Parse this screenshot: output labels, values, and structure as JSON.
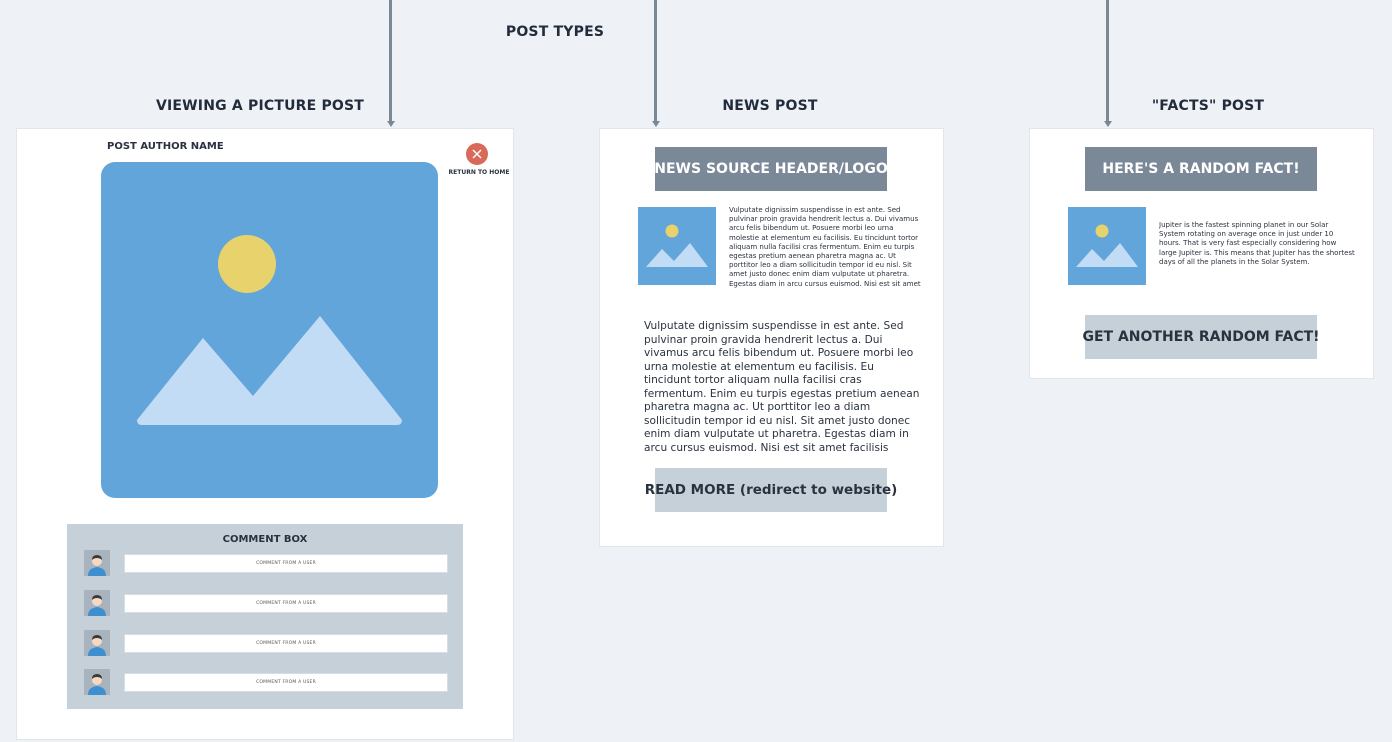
{
  "header": {
    "post_types_label": "POST TYPES"
  },
  "sections": {
    "picture": {
      "title": "VIEWING A PICTURE POST"
    },
    "news": {
      "title": "NEWS POST"
    },
    "facts": {
      "title": "\"FACTS\" POST"
    }
  },
  "picture_post": {
    "author_name": "POST AUTHOR NAME",
    "return_label": "RETURN TO HOME",
    "close_icon": "close-icon",
    "image_icon": "image-placeholder-icon",
    "comment_box": {
      "title": "COMMENT BOX",
      "comments": [
        {
          "text": "COMMENT FROM A USER"
        },
        {
          "text": "COMMENT FROM A USER"
        },
        {
          "text": "COMMENT FROM A USER"
        },
        {
          "text": "COMMENT FROM A USER"
        }
      ]
    }
  },
  "news_post": {
    "header_label": "NEWS SOURCE HEADER/LOGO",
    "summary": "Vulputate dignissim suspendisse in est ante. Sed pulvinar proin gravida hendrerit lectus a. Dui vivamus arcu felis bibendum ut. Posuere morbi leo urna molestie at elementum eu facilisis. Eu tincidunt tortor aliquam nulla facilisi cras fermentum. Enim eu turpis egestas pretium aenean pharetra magna ac. Ut porttitor leo a diam sollicitudin tempor id eu nisl. Sit amet justo donec enim diam vulputate ut pharetra. Egestas diam in arcu cursus euismod. Nisi est sit amet facilisis magna etiam tempor orci.",
    "body": "Vulputate dignissim suspendisse in est ante. Sed pulvinar proin gravida hendrerit lectus a. Dui vivamus arcu felis bibendum ut. Posuere morbi leo urna molestie at elementum eu facilisis. Eu tincidunt tortor aliquam nulla facilisi cras fermentum. Enim eu turpis egestas pretium aenean pharetra magna ac. Ut porttitor leo a diam sollicitudin tempor id eu nisl. Sit amet justo donec enim diam vulputate ut pharetra. Egestas diam in arcu cursus euismod. Nisi est sit amet facilisis magna etiam tempor orci.",
    "read_more_label": "READ MORE (redirect to website)"
  },
  "facts_post": {
    "header_label": "HERE'S A RANDOM FACT!",
    "fact_text": "Jupiter is the fastest spinning planet in our Solar System rotating on average once in just under 10 hours. That is very fast especially considering how large Jupiter is. This means that Jupiter has the shortest days of all the planets in the Solar System.",
    "another_fact_label": "GET ANOTHER RANDOM FACT!"
  },
  "colors": {
    "background": "#eef2f6",
    "image_blue": "#62a5da",
    "mountain_light": "#c2dcf5",
    "sun_yellow": "#e8d26b",
    "close_red": "#d86a5a",
    "button_dark": "#7a8898",
    "button_light": "#c6d0d9",
    "comment_panel": "#c6d0d9"
  }
}
